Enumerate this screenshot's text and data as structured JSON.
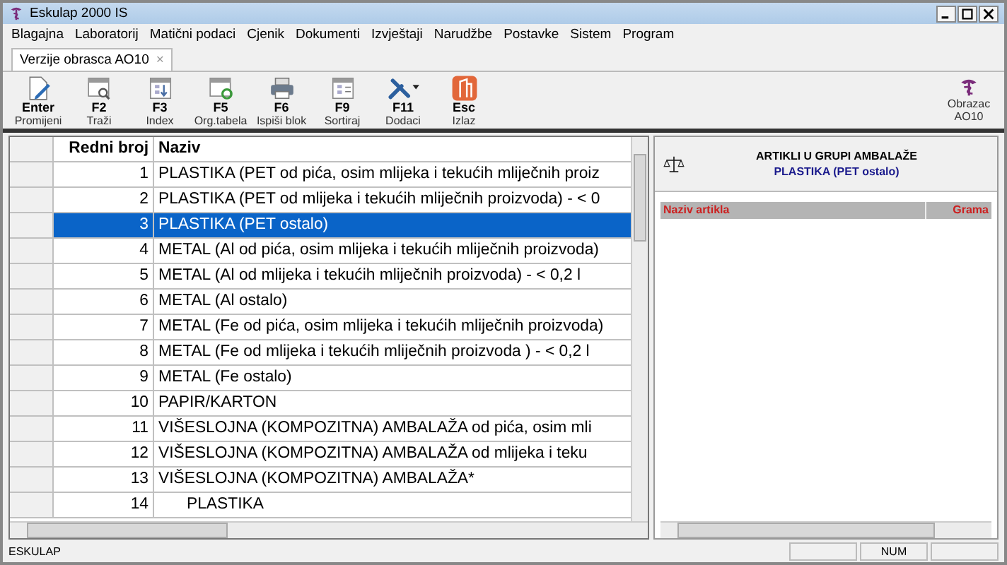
{
  "window": {
    "title": "Eskulap 2000  IS"
  },
  "menu": [
    "Blagajna",
    "Laboratorij",
    "Matični podaci",
    "Cjenik",
    "Dokumenti",
    "Izvještaji",
    "Narudžbe",
    "Postavke",
    "Sistem",
    "Program"
  ],
  "tabs": [
    {
      "label": "Verzije obrasca AO10",
      "selected": true,
      "close": "×"
    }
  ],
  "toolbar": {
    "buttons": [
      {
        "kind": "edit",
        "key": "Enter",
        "label": "Promijeni"
      },
      {
        "kind": "search",
        "key": "F2",
        "label": "Traži"
      },
      {
        "kind": "index",
        "key": "F3",
        "label": "Index"
      },
      {
        "kind": "refresh",
        "key": "F5",
        "label": "Org.tabela"
      },
      {
        "kind": "print",
        "key": "F6",
        "label": "Ispiši blok"
      },
      {
        "kind": "sort",
        "key": "F9",
        "label": "Sortiraj"
      },
      {
        "kind": "tools",
        "key": "F11",
        "label": "Dodaci"
      },
      {
        "kind": "exit",
        "key": "Esc",
        "label": "Izlaz"
      }
    ],
    "right_button": {
      "lines": [
        "Obrazac",
        "AO10"
      ]
    }
  },
  "grid": {
    "columns": [
      "Redni broj",
      "Naziv"
    ],
    "rows": [
      {
        "number": "1",
        "name": "PLASTIKA (PET od pića, osim mlijeka i tekućih mliječnih proiz",
        "selected": false
      },
      {
        "number": "2",
        "name": "PLASTIKA (PET od mlijeka i tekućih mliječnih proizvoda) - < 0",
        "selected": false
      },
      {
        "number": "3",
        "name": "PLASTIKA (PET ostalo)",
        "selected": true
      },
      {
        "number": "4",
        "name": "METAL (Al od pića, osim mlijeka i tekućih mliječnih proizvoda)",
        "selected": false
      },
      {
        "number": "5",
        "name": "METAL (Al od mlijeka i tekućih mliječnih proizvoda) - < 0,2 l",
        "selected": false
      },
      {
        "number": "6",
        "name": "METAL (Al ostalo)",
        "selected": false
      },
      {
        "number": "7",
        "name": "METAL (Fe od pića, osim mlijeka i tekućih mliječnih proizvoda)",
        "selected": false
      },
      {
        "number": "8",
        "name": "METAL (Fe od mlijeka i tekućih mliječnih proizvoda ) - < 0,2 l",
        "selected": false
      },
      {
        "number": "9",
        "name": "METAL (Fe ostalo)",
        "selected": false
      },
      {
        "number": "10",
        "name": "PAPIR/KARTON",
        "selected": false
      },
      {
        "number": "11",
        "name": "VIŠESLOJNA (KOMPOZITNA) AMBALAŽA od pića, osim mli",
        "selected": false
      },
      {
        "number": "12",
        "name": "VIŠESLOJNA (KOMPOZITNA) AMBALAŽA od mlijeka i teku",
        "selected": false
      },
      {
        "number": "13",
        "name": "VIŠESLOJNA (KOMPOZITNA) AMBALAŽA*",
        "selected": false,
        "children": [
          {
            "number": "14",
            "name": "PLASTIKA",
            "selected": false
          }
        ]
      }
    ]
  },
  "panel": {
    "title": "ARTIKLI U GRUPI AMBALAŽE",
    "subtitle": "PLASTIKA (PET ostalo)",
    "columns": [
      "Naziv artikla",
      "Grama"
    ]
  },
  "status_bar": {
    "text": "ESKULAP",
    "indicator": "NUM"
  }
}
